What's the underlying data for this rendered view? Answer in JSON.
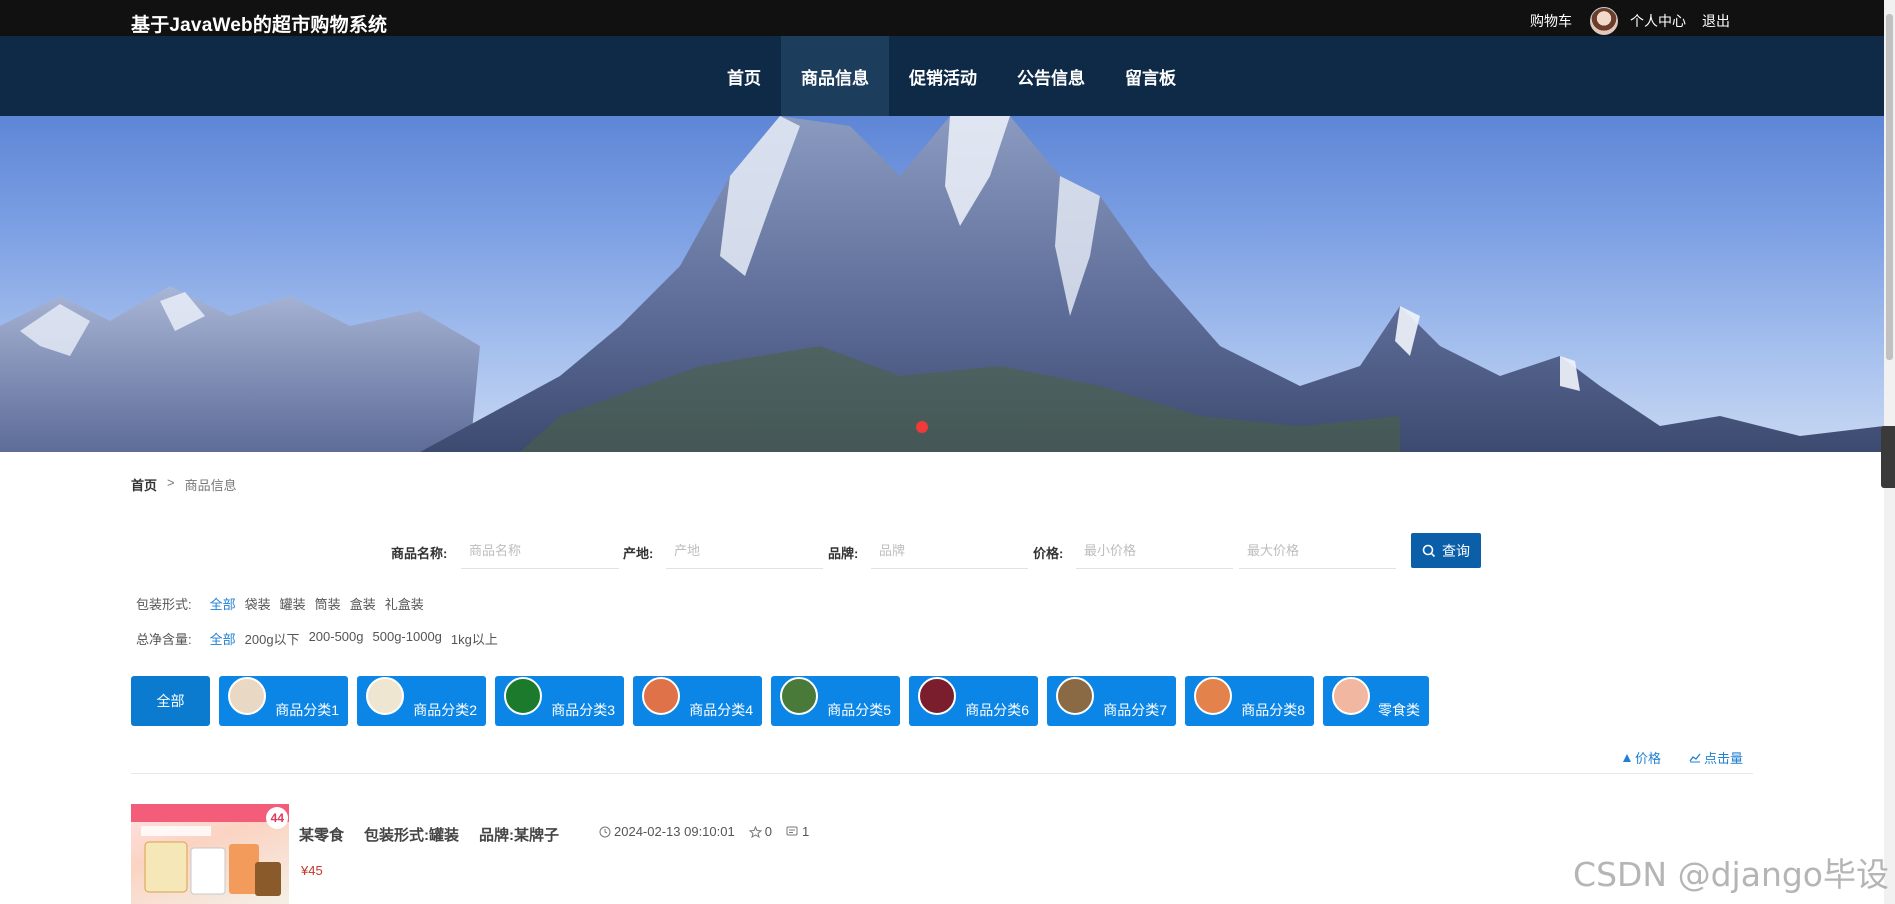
{
  "header": {
    "site_title": "基于JavaWeb的超市购物系统",
    "cart_label": "购物车",
    "user_center_label": "个人中心",
    "logout_label": "退出"
  },
  "nav": {
    "items": [
      {
        "label": "首页",
        "active": false
      },
      {
        "label": "商品信息",
        "active": true
      },
      {
        "label": "促销活动",
        "active": false
      },
      {
        "label": "公告信息",
        "active": false
      },
      {
        "label": "留言板",
        "active": false
      }
    ]
  },
  "breadcrumb": {
    "home": "首页",
    "separator": ">",
    "current": "商品信息"
  },
  "search": {
    "name_label": "商品名称:",
    "name_placeholder": "商品名称",
    "origin_label": "产地:",
    "origin_placeholder": "产地",
    "brand_label": "品牌:",
    "brand_placeholder": "品牌",
    "price_label": "价格:",
    "min_price_placeholder": "最小价格",
    "max_price_placeholder": "最大价格",
    "button_label": "查询"
  },
  "filters": {
    "packaging": {
      "label": "包装形式:",
      "options": [
        "全部",
        "袋装",
        "罐装",
        "筒装",
        "盒装",
        "礼盒装"
      ],
      "selected": "全部"
    },
    "net_weight": {
      "label": "总净含量:",
      "options": [
        "全部",
        "200g以下",
        "200-500g",
        "500g-1000g",
        "1kg以上"
      ],
      "selected": "全部"
    }
  },
  "categories": {
    "all_label": "全部",
    "items": [
      {
        "label": "商品分类1",
        "thumb_color": "#e9d9c4"
      },
      {
        "label": "商品分类2",
        "thumb_color": "#efe6d2"
      },
      {
        "label": "商品分类3",
        "thumb_color": "#1c7a2c"
      },
      {
        "label": "商品分类4",
        "thumb_color": "#e0724a"
      },
      {
        "label": "商品分类5",
        "thumb_color": "#4a7a3a"
      },
      {
        "label": "商品分类6",
        "thumb_color": "#7a1e2e"
      },
      {
        "label": "商品分类7",
        "thumb_color": "#8a6a44"
      },
      {
        "label": "商品分类8",
        "thumb_color": "#e3824a"
      },
      {
        "label": "零食类",
        "thumb_color": "#f2b7a0"
      }
    ]
  },
  "sort": {
    "price_label": "价格",
    "clicks_label": "点击量"
  },
  "product": {
    "name": "某零食",
    "packaging": "包装形式:罐装",
    "brand": "品牌:某牌子",
    "datetime": "2024-02-13 09:10:01",
    "favorites": "0",
    "comments": "1",
    "price": "¥45",
    "image_badge": "44"
  },
  "watermark": "CSDN @django毕设",
  "colors": {
    "topbar": "#111111",
    "nav": "#0e2a47",
    "accent": "#0b86e6",
    "link": "#1f7fd1",
    "price": "#c0392b"
  }
}
